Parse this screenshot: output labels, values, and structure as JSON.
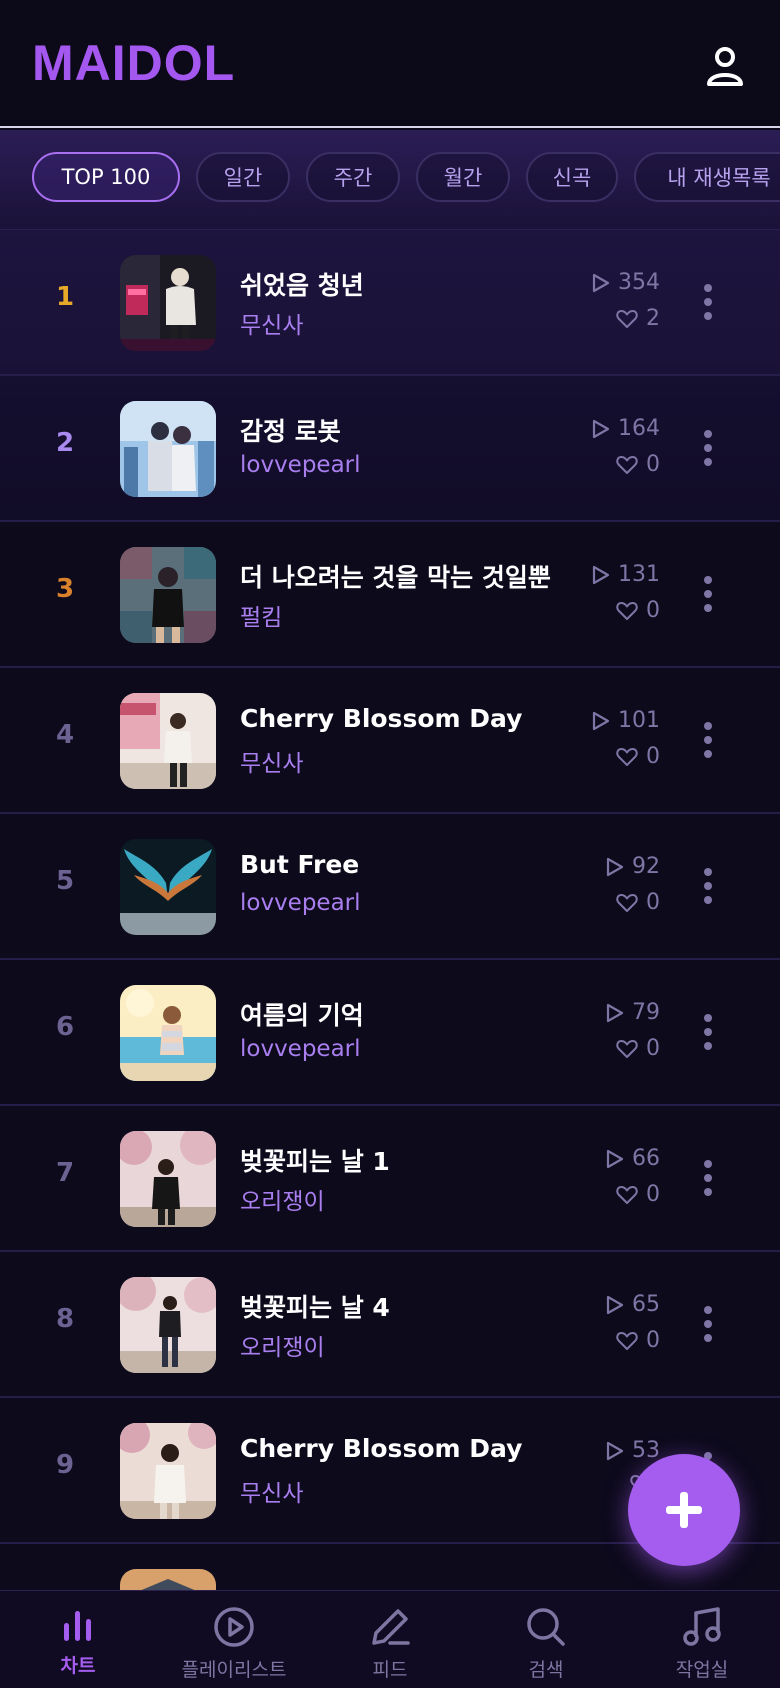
{
  "app": {
    "logo": "MAIDOL"
  },
  "colors": {
    "accent": "#a55df0",
    "background": "#0d0a1c",
    "rank_gold": "#e6a92a",
    "rank_silver": "#a98af0",
    "rank_bronze": "#d9822b"
  },
  "filters": [
    {
      "label": "TOP 100",
      "active": true
    },
    {
      "label": "일간"
    },
    {
      "label": "주간"
    },
    {
      "label": "월간"
    },
    {
      "label": "신곡"
    },
    {
      "label": "내 재생목록"
    }
  ],
  "songs": [
    {
      "rank": "1",
      "title": "쉬었음 청년",
      "artist": "무신사",
      "plays": "354",
      "likes": "2"
    },
    {
      "rank": "2",
      "title": "감정 로봇",
      "artist": "lovvepearl",
      "plays": "164",
      "likes": "0"
    },
    {
      "rank": "3",
      "title": "더 나오려는 것을 막는 것일뿐",
      "artist": "펄킴",
      "plays": "131",
      "likes": "0"
    },
    {
      "rank": "4",
      "title": "Cherry Blossom Day",
      "artist": "무신사",
      "plays": "101",
      "likes": "0"
    },
    {
      "rank": "5",
      "title": "But Free",
      "artist": "lovvepearl",
      "plays": "92",
      "likes": "0"
    },
    {
      "rank": "6",
      "title": "여름의 기억",
      "artist": "lovvepearl",
      "plays": "79",
      "likes": "0"
    },
    {
      "rank": "7",
      "title": "벚꽃피는 날 1",
      "artist": "오리쟁이",
      "plays": "66",
      "likes": "0"
    },
    {
      "rank": "8",
      "title": "벚꽃피는 날 4",
      "artist": "오리쟁이",
      "plays": "65",
      "likes": "0"
    },
    {
      "rank": "9",
      "title": "Cherry Blossom Day",
      "artist": "무신사",
      "plays": "53",
      "likes": ""
    }
  ],
  "nav": [
    {
      "label": "차트",
      "icon": "chart-icon",
      "active": true
    },
    {
      "label": "플레이리스트",
      "icon": "play-circle-icon"
    },
    {
      "label": "피드",
      "icon": "pen-icon"
    },
    {
      "label": "검색",
      "icon": "search-icon"
    },
    {
      "label": "작업실",
      "icon": "music-note-icon"
    }
  ],
  "icons": {
    "profile": "user-icon",
    "fab": "plus-icon",
    "more": "more-vertical-icon"
  }
}
